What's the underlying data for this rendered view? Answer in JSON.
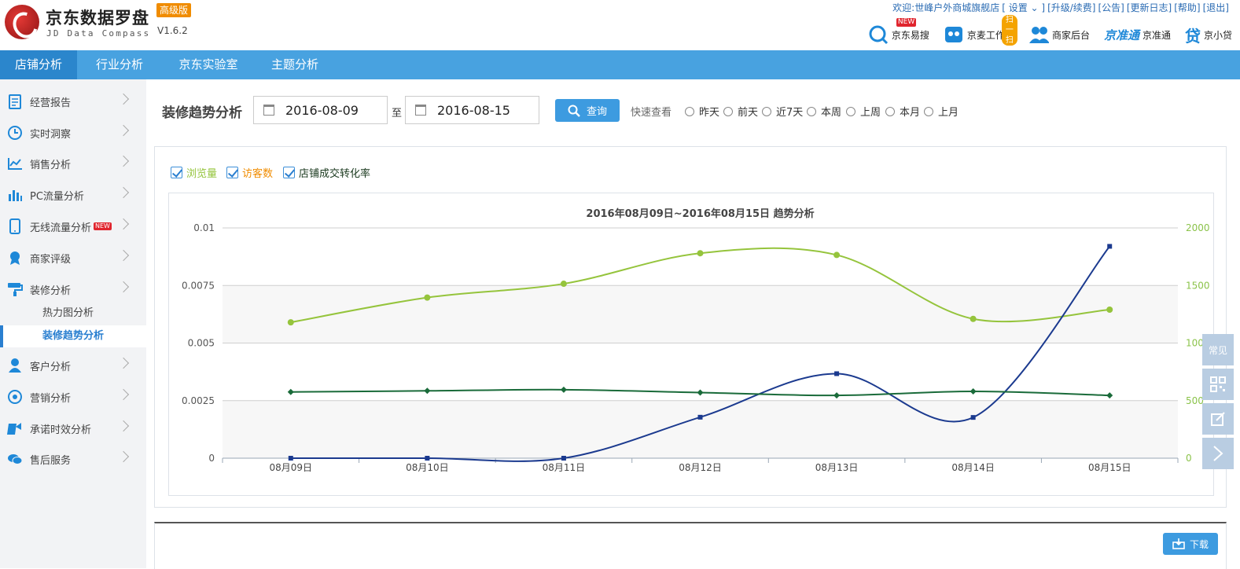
{
  "app": {
    "title": "京东数据罗盘",
    "edition": "高级版",
    "subtitle": "JD Data Compass",
    "version": "V1.6.2"
  },
  "top_links": {
    "welcome": "欢迎:世峰户外商城旗舰店",
    "settings": "[ 设置 ⌄ ]",
    "upgrade": "[升级/续费]",
    "notice": "[公告]",
    "changelog": "[更新日志]",
    "help": "[帮助]",
    "logout": "[退出]"
  },
  "tools": [
    {
      "label": "京东易搜",
      "badge": "NEW",
      "icon": "search-circle-icon"
    },
    {
      "label": "京麦工作台",
      "badge": "扫一扫",
      "icon": "robot-icon"
    },
    {
      "label": "商家后台",
      "badge": "",
      "icon": "users-icon"
    },
    {
      "label": "京准通",
      "badge": "",
      "icon": "jzt-logo-icon",
      "logo_text": "京准通"
    },
    {
      "label": "京小贷",
      "badge": "",
      "icon": "loan-icon",
      "logo_text": "贷"
    }
  ],
  "nav": {
    "tabs": [
      "店铺分析",
      "行业分析",
      "京东实验室",
      "主题分析"
    ],
    "active": 0
  },
  "sidebar": {
    "items": [
      {
        "label": "经营报告",
        "icon": "report-icon"
      },
      {
        "label": "实时洞察",
        "icon": "clock-icon"
      },
      {
        "label": "销售分析",
        "icon": "line-chart-icon"
      },
      {
        "label": "PC流量分析",
        "icon": "bar-chart-icon"
      },
      {
        "label": "无线流量分析",
        "icon": "mobile-icon",
        "badge": "NEW"
      },
      {
        "label": "商家评级",
        "icon": "medal-icon"
      },
      {
        "label": "装修分析",
        "icon": "brush-icon"
      },
      {
        "label": "客户分析",
        "icon": "user-icon"
      },
      {
        "label": "营销分析",
        "icon": "target-icon"
      },
      {
        "label": "承诺时效分析",
        "icon": "promise-icon"
      },
      {
        "label": "售后服务",
        "icon": "chat-icon"
      }
    ],
    "sub_items": [
      {
        "label": "热力图分析"
      },
      {
        "label": "装修趋势分析",
        "active": true
      }
    ]
  },
  "page": {
    "title": "装修趋势分析",
    "start_date": "2016-08-09",
    "to": "至",
    "end_date": "2016-08-15",
    "query": "查询",
    "quick_view": "快速查看",
    "quick_options": [
      "昨天",
      "前天",
      "近7天",
      "本周",
      "上周",
      "本月",
      "上月"
    ]
  },
  "legend": [
    {
      "label": "浏览量",
      "color": "#8bc34a"
    },
    {
      "label": "访客数",
      "color": "#f08c00"
    },
    {
      "label": "店铺成交转化率",
      "color": "#1b5e35"
    }
  ],
  "float_buttons": {
    "faq": "常见"
  },
  "download": "下载",
  "colors": {
    "nav": "#48a2e0",
    "nav_active": "#2b86cc",
    "pv": "#95c43c",
    "uv": "#1b3a8f",
    "conv": "#1a6b3a",
    "accent": "#3d9be0"
  },
  "chart_data": {
    "type": "line",
    "title": "2016年08月09日~2016年08月15日 趋势分析",
    "categories": [
      "08月09日",
      "08月10日",
      "08月11日",
      "08月12日",
      "08月13日",
      "08月14日",
      "08月15日"
    ],
    "left_axis": {
      "min": 0,
      "max": 0.01,
      "ticks": [
        "0",
        "0.0025",
        "0.005",
        "0.0075",
        "0.01"
      ]
    },
    "right_axis": {
      "min": 0,
      "max": 2000,
      "ticks": [
        "0",
        "500",
        "1000",
        "1500",
        "2000"
      ]
    },
    "series": [
      {
        "name": "浏览量",
        "axis": "right",
        "color": "#95c43c",
        "marker": "circle",
        "values": [
          1180,
          1395,
          1515,
          1780,
          1765,
          1210,
          1290
        ]
      },
      {
        "name": "访客数",
        "axis": "left",
        "color": "#1b3a8f",
        "marker": "square",
        "values": [
          0,
          0,
          0,
          0.00178,
          0.00367,
          0.00177,
          0.0092
        ]
      },
      {
        "name": "店铺成交转化率",
        "axis": "right",
        "color": "#1a6b3a",
        "marker": "diamond",
        "values": [
          575,
          585,
          595,
          570,
          545,
          580,
          545
        ]
      }
    ]
  }
}
